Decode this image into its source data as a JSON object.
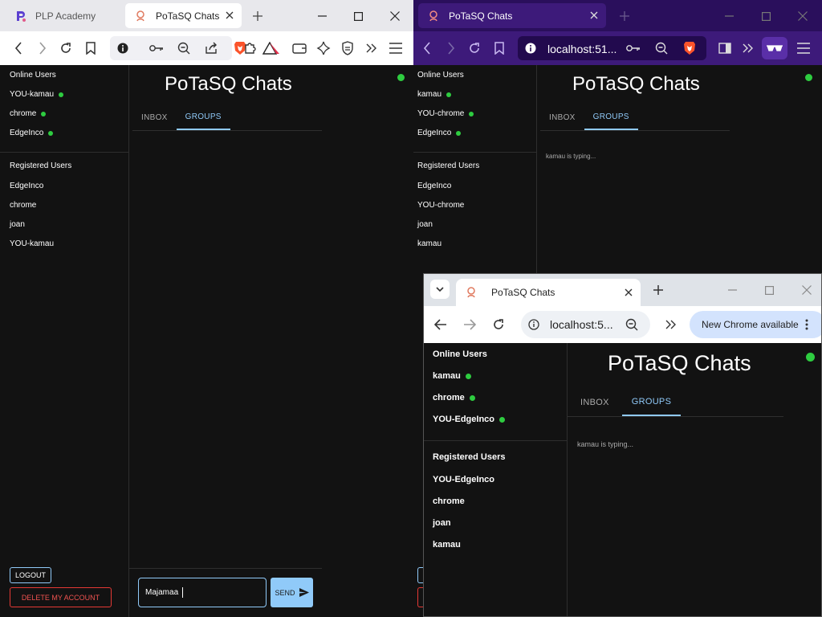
{
  "win1": {
    "tabs": [
      {
        "title": "PLP Academy"
      },
      {
        "title": "PoTaSQ Chats"
      }
    ],
    "app": {
      "title": "PoTaSQ Chats",
      "online_heading": "Online Users",
      "online_users": [
        "YOU-kamau",
        "chrome",
        "EdgeInco"
      ],
      "registered_heading": "Registered Users",
      "registered_users": [
        "EdgeInco",
        "chrome",
        "joan",
        "YOU-kamau"
      ],
      "tabs": [
        "INBOX",
        "GROUPS"
      ],
      "active_tab": "GROUPS",
      "logout_label": "LOGOUT",
      "delete_label": "DELETE MY ACCOUNT",
      "message_value": "Majamaa",
      "send_label": "SEND"
    }
  },
  "win2": {
    "tab_title": "PoTaSQ Chats",
    "url": "localhost:51...",
    "app": {
      "title": "PoTaSQ Chats",
      "online_heading": "Online Users",
      "online_users": [
        "kamau",
        "YOU-chrome",
        "EdgeInco"
      ],
      "registered_heading": "Registered Users",
      "registered_users": [
        "EdgeInco",
        "YOU-chrome",
        "joan",
        "kamau"
      ],
      "tabs": [
        "INBOX",
        "GROUPS"
      ],
      "active_tab": "GROUPS",
      "typing": "kamau is typing..."
    }
  },
  "win3": {
    "tab_title": "PoTaSQ Chats",
    "url": "localhost:5...",
    "update_label": "New Chrome available",
    "app": {
      "title": "PoTaSQ Chats",
      "online_heading": "Online Users",
      "online_users": [
        "kamau",
        "chrome",
        "YOU-EdgeInco"
      ],
      "registered_heading": "Registered Users",
      "registered_users": [
        "YOU-EdgeInco",
        "chrome",
        "joan",
        "kamau"
      ],
      "tabs": [
        "INBOX",
        "GROUPS"
      ],
      "active_tab": "GROUPS",
      "typing": "kamau is typing..."
    }
  },
  "colors": {
    "app_bg": "#121212",
    "accent": "#90caf9",
    "online": "#2ecc40",
    "danger": "#e53935",
    "brave_purple": "#3d1a7a"
  }
}
